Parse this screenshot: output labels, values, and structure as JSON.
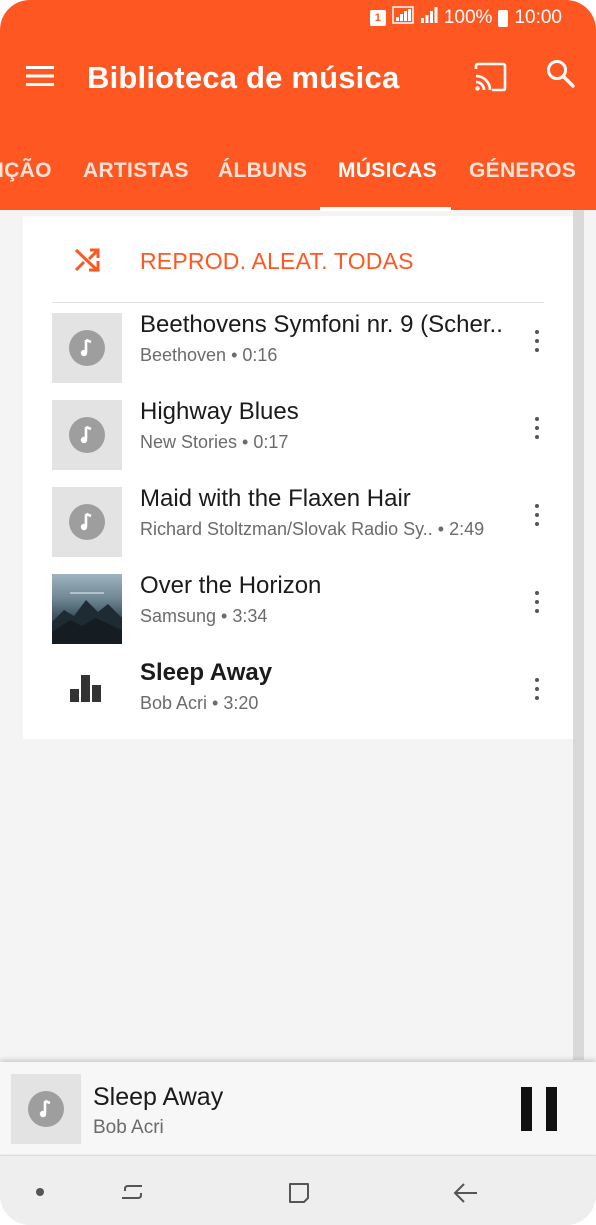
{
  "status_bar": {
    "sim": "1",
    "battery_percent": "100%",
    "time": "10:00",
    "icons": [
      "sim-icon",
      "wifi-signal-icon",
      "cell-signal-icon",
      "battery-icon"
    ]
  },
  "app_bar": {
    "title": "Biblioteca de música",
    "icons": [
      "menu-icon",
      "cast-icon",
      "search-icon"
    ]
  },
  "tabs": [
    {
      "label": "IÇÃO",
      "active": false
    },
    {
      "label": "ARTISTAS",
      "active": false
    },
    {
      "label": "ÁLBUNS",
      "active": false
    },
    {
      "label": "MÚSICAS",
      "active": true
    },
    {
      "label": "GÉNEROS",
      "active": false
    }
  ],
  "shuffle": {
    "label": "REPROD. ALEAT. TODAS",
    "icon": "shuffle-icon",
    "color": "#ff5722"
  },
  "songs": [
    {
      "title": "Beethovens Symfoni nr. 9 (Scher..",
      "subtitle": "Beethoven • 0:16",
      "thumb": "music-note-icon",
      "playing": false
    },
    {
      "title": "Highway Blues",
      "subtitle": "New Stories • 0:17",
      "thumb": "music-note-icon",
      "playing": false
    },
    {
      "title": "Maid with the Flaxen Hair",
      "subtitle": "Richard Stoltzman/Slovak Radio Sy..  • 2:49",
      "thumb": "music-note-icon",
      "playing": false
    },
    {
      "title": "Over the Horizon",
      "subtitle": "Samsung • 3:34",
      "thumb": "album-art",
      "playing": false
    },
    {
      "title": "Sleep Away",
      "subtitle": "Bob Acri • 3:20",
      "thumb": "equalizer-icon",
      "playing": true
    }
  ],
  "mini_player": {
    "title": "Sleep Away",
    "artist": "Bob Acri",
    "icons": [
      "music-note-icon",
      "pause-icon"
    ]
  },
  "nav_bar": {
    "icons": [
      "dot-icon",
      "recent-apps-icon",
      "home-icon",
      "back-icon"
    ]
  },
  "colors": {
    "accent": "#ff5722",
    "background": "#f4f4f4"
  }
}
